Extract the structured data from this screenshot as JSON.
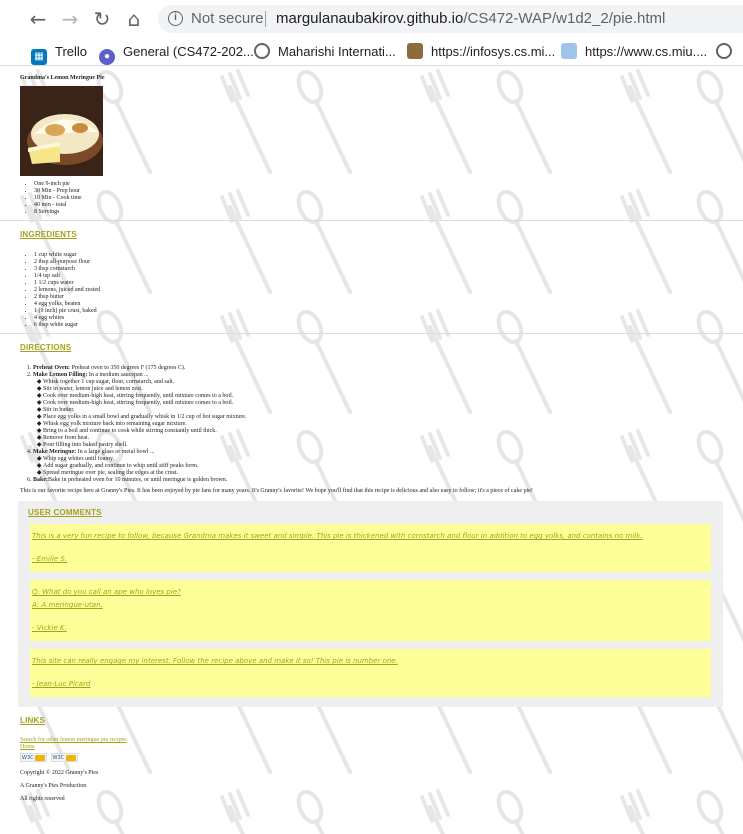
{
  "browser": {
    "security_label": "Not secure",
    "url_host": "margulanaubakirov.github.io",
    "url_path": "/CS472-WAP/w1d2_2/pie.html",
    "bookmarks": [
      {
        "label": "Trello",
        "icon": "trello-icon"
      },
      {
        "label": "General (CS472-202...",
        "icon": "teams-icon"
      },
      {
        "label": "Maharishi Internati...",
        "icon": "globe-icon"
      },
      {
        "label": "https://infosys.cs.mi...",
        "icon": "image-icon"
      },
      {
        "label": "https://www.cs.miu....",
        "icon": "document-icon"
      }
    ]
  },
  "page": {
    "title": "Grandma's Lemon Meringue Pie",
    "summary": [
      "One 9-inch pie",
      "30 Min - Prep hour",
      "10 Min - Cook time",
      "40 min - total",
      "8 Servings"
    ],
    "ingredients_heading": "INGREDIENTS",
    "ingredients": [
      "1 cup white sugar",
      "2 tbsp all-purpose flour",
      "3 tbsp cornstarch",
      "1/4 tsp salt",
      "1 1/2 cups water",
      "2 lemons, juiced and zested",
      "2 tbsp butter",
      "4 egg yolks, beaten",
      "1 (9 inch) pie crust, baked",
      "4 egg whites",
      "6 tbsp white sugar"
    ],
    "directions_heading": "DIRECTIONS",
    "directions": {
      "step1_label": "Preheat Oven:",
      "step1_text": " Preheat oven to 350 degrees F (175 degrees C).",
      "step2_label": "Make Lemon Filling:",
      "step2_text": " In a medium saucepan ...",
      "step2_sub": [
        "Whisk together 1 cup sugar, flour, cornstarch, and salt.",
        "Stir in water, lemon juice and lemon zest.",
        "Cook over medium-high heat, stirring frequently, until mixture comes to a boil.",
        "Cook over medium-high heat, stirring frequently, until mixture comes to a boil.",
        "Stir in butter.",
        "Place egg yolks in a small bowl and gradually whisk in 1/2 cup of hot sugar mixture.",
        "Whisk egg yolk mixture back into remaining sugar mixture.",
        "Bring to a boil and continue to cook while stirring constantly until thick.",
        "Remove from heat.",
        "Pour filling into baked pastry shell."
      ],
      "step4_label": "Make Meringue:",
      "step4_text": " In a large glass or metal bowl ...",
      "step4_sub": [
        "Whip egg whites until foamy.",
        "Add sugar gradually, and continue to whip until stiff peaks form.",
        "Spread meringue over pie, sealing the edges at the crust."
      ],
      "step6_label": "Bake:",
      "step6_text": "Bake in preheated oven for 10 minutes, or until meringue is golden brown."
    },
    "intro": "This is our favorite recipe here at Granny's Pies. It has been enjoyed by pie fans for many years. It's Granny's favorite! We hope you'll find that this recipe is delicious and also easy to follow; it's a piece of cake pie!",
    "comments_heading": "USER COMMENTS",
    "comments": [
      {
        "lines": [
          "This is a very fun recipe to follow, because Grandma makes it sweet and simple. This pie is thickened with cornstarch and flour in addition to egg yolks, and contains no milk."
        ],
        "author": "- Emilie S."
      },
      {
        "lines": [
          "Q: What do you call an ape who loves pie?",
          "A: A meringue-utan."
        ],
        "author": "- Vickie K."
      },
      {
        "lines": [
          "This site can really engage my interest. Follow the recipe above and make it so! This pie is number one."
        ],
        "author": "- Jean-Luc Picard"
      }
    ],
    "links_heading": "LINKS",
    "links": [
      "Search for other lemon meringue pie recipes",
      "Home"
    ],
    "badges": [
      "W3C",
      "W3C"
    ],
    "footer": [
      "Copyright © 2022 Granny's Pies",
      "A Granny's Pies Production",
      "All rights reserved"
    ]
  },
  "colors": {
    "heading": "#a3a31a",
    "comment_bg": "#ffff99",
    "comments_box_bg": "#efefef"
  }
}
